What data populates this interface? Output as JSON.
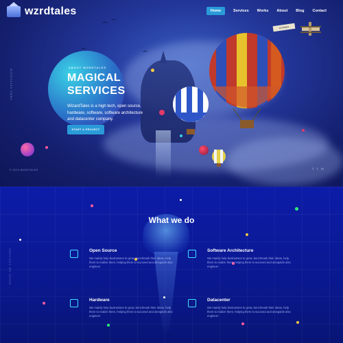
{
  "brand": {
    "name": "wzrdtales"
  },
  "nav": {
    "items": [
      "Home",
      "Services",
      "Works",
      "About",
      "Blog",
      "Contact"
    ],
    "active": "Home"
  },
  "hero": {
    "eyebrow": "ABOUT WZRDTALES",
    "title_line1": "MAGICAL",
    "title_line2": "SERVICES",
    "description": "WizardTales is a high tech, open source, hardware, software, software architecture and datacenter company.",
    "cta_label": "START A PROJECT",
    "side_text": "WZRDTALES GMBH",
    "year": "© 2019 WZRDTALES",
    "banner_text": "wzrdtales"
  },
  "services": {
    "title": "What we do",
    "side_text": "SERVICES WE OFFER",
    "items": [
      {
        "title": "Open Source",
        "icon": "code-icon",
        "description": "We mainly help businesses to grow, benchmark their ideas, help them to realize them, helping them to succeed and alongside also engineer"
      },
      {
        "title": "Software Architecture",
        "icon": "monitor-icon",
        "description": "We mainly help businesses to grow, benchmark their ideas, help them to realize them, helping them to succeed and alongside also engineer"
      },
      {
        "title": "Hardware",
        "icon": "chip-icon",
        "description": "We mainly help businesses to grow, benchmark their ideas, help them to realize them, helping them to succeed and alongside also engineer"
      },
      {
        "title": "Datacenter",
        "icon": "server-icon",
        "description": "We mainly help businesses to grow, benchmark their ideas, help them to realize them, helping them to succeed and alongside also engineer"
      }
    ]
  },
  "social": {
    "items": [
      "f",
      "t",
      "in"
    ]
  },
  "colors": {
    "accent": "#2a9bd8",
    "icon": "#43e0ff",
    "bg_top": "#23379a",
    "bg_bottom": "#0b1a8c"
  }
}
